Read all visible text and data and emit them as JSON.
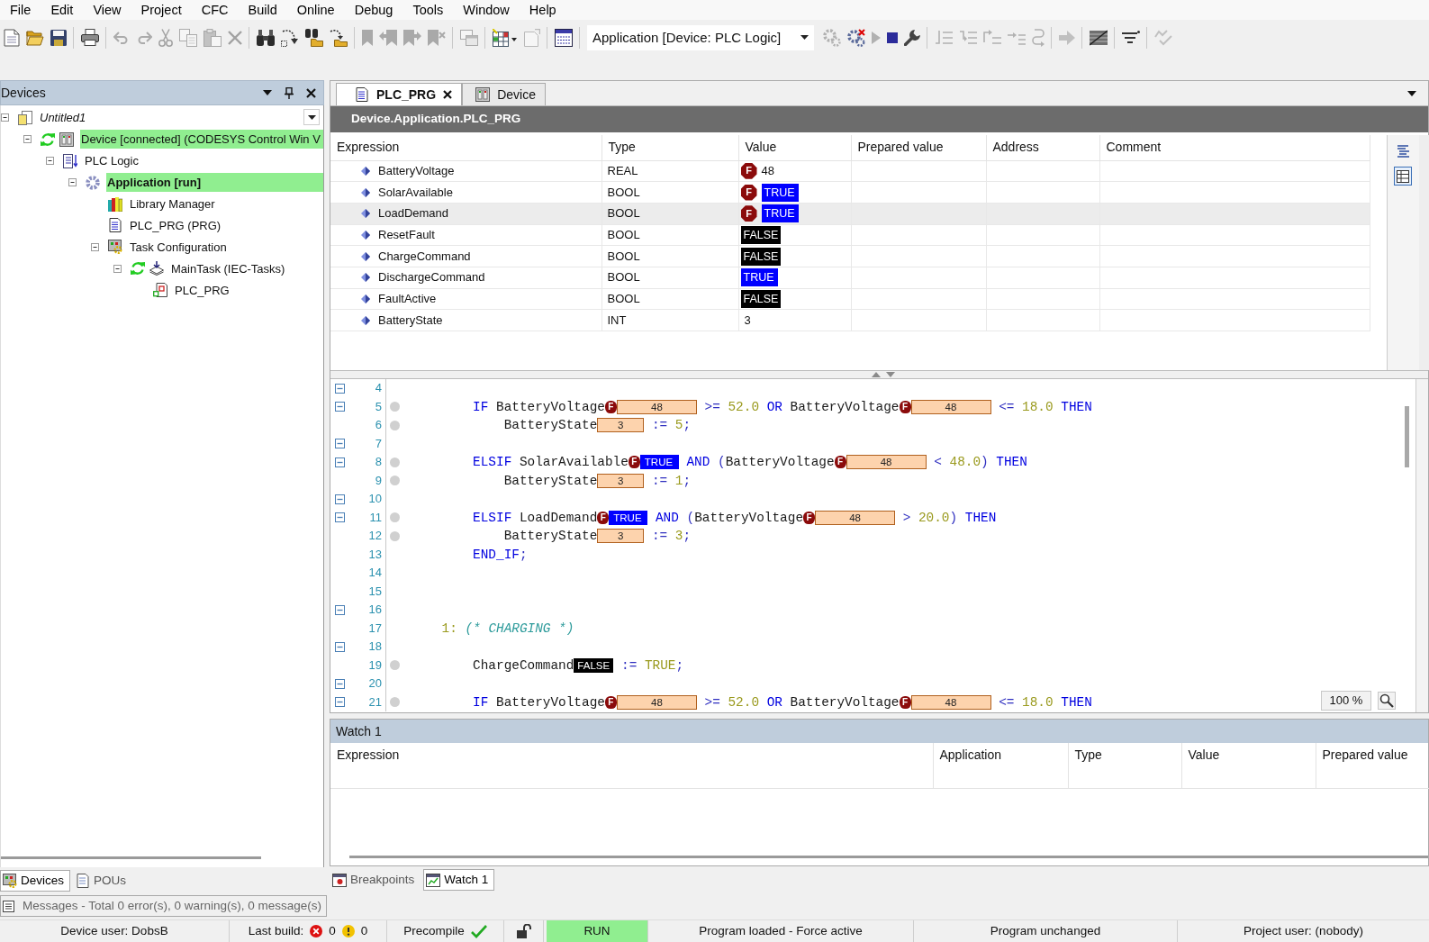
{
  "menu": [
    "File",
    "Edit",
    "View",
    "Project",
    "CFC",
    "Build",
    "Online",
    "Debug",
    "Tools",
    "Window",
    "Help"
  ],
  "toolbar": [
    {
      "kind": "new",
      "disabled": false
    },
    {
      "kind": "open",
      "disabled": false
    },
    {
      "kind": "save",
      "disabled": false
    },
    {
      "kind": "separator"
    },
    {
      "kind": "print",
      "disabled": false
    },
    {
      "kind": "separator"
    },
    {
      "kind": "undo",
      "disabled": true
    },
    {
      "kind": "redo",
      "disabled": true
    },
    {
      "kind": "cut",
      "disabled": true
    },
    {
      "kind": "copy",
      "disabled": true
    },
    {
      "kind": "paste",
      "disabled": true
    },
    {
      "kind": "delete",
      "disabled": true
    },
    {
      "kind": "separator"
    },
    {
      "kind": "find",
      "disabled": false
    },
    {
      "kind": "findnext",
      "disabled": false
    },
    {
      "kind": "findfiles",
      "disabled": false
    },
    {
      "kind": "replacefiles",
      "disabled": false
    },
    {
      "kind": "separator"
    },
    {
      "kind": "bookmark",
      "disabled": true
    },
    {
      "kind": "bmprev",
      "disabled": true
    },
    {
      "kind": "bmnext",
      "disabled": true
    },
    {
      "kind": "bmclear",
      "disabled": true
    },
    {
      "kind": "separator"
    },
    {
      "kind": "windows",
      "disabled": true
    },
    {
      "kind": "separator"
    },
    {
      "kind": "grid",
      "disabled": false
    },
    {
      "kind": "page",
      "disabled": true
    },
    {
      "kind": "separator"
    },
    {
      "kind": "watch",
      "disabled": false
    },
    {
      "kind": "separator"
    },
    {
      "kind": "selector",
      "text": "Application [Device: PLC Logic]"
    },
    {
      "kind": "login",
      "disabled": true
    },
    {
      "kind": "logout",
      "disabled": false
    },
    {
      "kind": "start",
      "disabled": true
    },
    {
      "kind": "stop",
      "disabled": false
    },
    {
      "kind": "reset",
      "disabled": false
    },
    {
      "kind": "separator"
    },
    {
      "kind": "stepover",
      "disabled": true
    },
    {
      "kind": "stepinto",
      "disabled": true
    },
    {
      "kind": "stepout",
      "disabled": true
    },
    {
      "kind": "runtocursor",
      "disabled": true
    },
    {
      "kind": "shownext",
      "disabled": true
    },
    {
      "kind": "separator"
    },
    {
      "kind": "arrow",
      "disabled": true
    },
    {
      "kind": "separator"
    },
    {
      "kind": "flag",
      "disabled": false
    },
    {
      "kind": "separator"
    },
    {
      "kind": "filter",
      "disabled": false
    },
    {
      "kind": "separator"
    },
    {
      "kind": "check",
      "disabled": true
    }
  ],
  "devices_panel": {
    "title": "Devices",
    "tree": [
      {
        "label": "Untitled1",
        "kind": "project",
        "expanded": true,
        "running": false,
        "highlighted": false,
        "active": false,
        "children": [
          {
            "label": "Device [connected] (CODESYS Control Win V",
            "kind": "device",
            "expanded": true,
            "running": true,
            "highlighted": true,
            "active": false,
            "children": [
              {
                "label": "PLC Logic",
                "kind": "plclogic",
                "expanded": true,
                "running": false,
                "highlighted": false,
                "active": false,
                "children": [
                  {
                    "label": "Application [run]",
                    "kind": "application",
                    "expanded": true,
                    "running": false,
                    "highlighted": true,
                    "active": true,
                    "children": [
                      {
                        "label": "Library Manager",
                        "kind": "library",
                        "running": false,
                        "highlighted": false,
                        "active": false
                      },
                      {
                        "label": "PLC_PRG (PRG)",
                        "kind": "pou",
                        "running": false,
                        "highlighted": false,
                        "active": false
                      },
                      {
                        "label": "Task Configuration",
                        "kind": "taskconfig",
                        "expanded": true,
                        "running": false,
                        "highlighted": false,
                        "active": false,
                        "children": [
                          {
                            "label": "MainTask (IEC-Tasks)",
                            "kind": "task",
                            "expanded": true,
                            "running": true,
                            "highlighted": false,
                            "active": false,
                            "children": [
                              {
                                "label": "PLC_PRG",
                                "kind": "taskpou",
                                "running": false,
                                "highlighted": false,
                                "active": false
                              }
                            ]
                          }
                        ]
                      }
                    ]
                  }
                ]
              }
            ]
          }
        ]
      }
    ],
    "tabs": [
      {
        "label": "Devices",
        "kind": "devices",
        "selected": true
      },
      {
        "label": "POUs",
        "kind": "pous",
        "selected": false
      }
    ]
  },
  "editor": {
    "tabs": [
      {
        "label": "PLC_PRG",
        "kind": "pou",
        "selected": true
      },
      {
        "label": "Device",
        "kind": "device",
        "selected": false
      }
    ],
    "path": "Device.Application.PLC_PRG",
    "variables": {
      "columns": [
        "Expression",
        "Type",
        "Value",
        "Prepared value",
        "Address",
        "Comment"
      ],
      "rows": [
        {
          "expression": "BatteryVoltage",
          "type": "REAL",
          "value": "48",
          "kind": "real",
          "force_mark": "F",
          "selected": false
        },
        {
          "expression": "SolarAvailable",
          "type": "BOOL",
          "value": "TRUE",
          "kind": "true",
          "force_mark": "F",
          "selected": false
        },
        {
          "expression": "LoadDemand",
          "type": "BOOL",
          "value": "TRUE",
          "kind": "true",
          "force_mark": "F",
          "selected": true
        },
        {
          "expression": "ResetFault",
          "type": "BOOL",
          "value": "FALSE",
          "kind": "false",
          "selected": false
        },
        {
          "expression": "ChargeCommand",
          "type": "BOOL",
          "value": "FALSE",
          "kind": "false",
          "selected": false
        },
        {
          "expression": "DischargeCommand",
          "type": "BOOL",
          "value": "TRUE",
          "kind": "true",
          "selected": false
        },
        {
          "expression": "FaultActive",
          "type": "BOOL",
          "value": "FALSE",
          "kind": "false",
          "selected": false
        },
        {
          "expression": "BatteryState",
          "type": "INT",
          "value": "3",
          "kind": "int",
          "selected": false
        }
      ],
      "view_modes": [
        {
          "kind": "text",
          "selected": false
        },
        {
          "kind": "table",
          "selected": true
        }
      ]
    },
    "code": [
      {
        "number": "4",
        "fold": true,
        "breakpoint": false
      },
      {
        "number": "5",
        "fold": true,
        "breakpoint": true,
        "tokens": [
          {
            "kind": "keyword",
            "text": "        IF"
          },
          {
            "kind": "name",
            "text": " BatteryVoltage"
          },
          {
            "kind": "real",
            "value": "48",
            "force_mark": "F"
          },
          {
            "kind": "operator",
            "text": " >="
          },
          {
            "kind": "number",
            "text": " 52.0"
          },
          {
            "kind": "keyword",
            "text": " OR"
          },
          {
            "kind": "name",
            "text": " BatteryVoltage"
          },
          {
            "kind": "real",
            "value": "48",
            "force_mark": "F"
          },
          {
            "kind": "operator",
            "text": " <="
          },
          {
            "kind": "number",
            "text": " 18.0"
          },
          {
            "kind": "keyword",
            "text": " THEN"
          }
        ]
      },
      {
        "number": "6",
        "fold": false,
        "breakpoint": true,
        "tokens": [
          {
            "kind": "name",
            "text": "            BatteryState"
          },
          {
            "kind": "int",
            "value": "3"
          },
          {
            "kind": "operator",
            "text": " :="
          },
          {
            "kind": "number",
            "text": " 5"
          },
          {
            "kind": "operator",
            "text": ";"
          }
        ]
      },
      {
        "number": "7",
        "fold": true,
        "breakpoint": false
      },
      {
        "number": "8",
        "fold": true,
        "breakpoint": true,
        "tokens": [
          {
            "kind": "keyword",
            "text": "        ELSIF"
          },
          {
            "kind": "name",
            "text": " SolarAvailable"
          },
          {
            "kind": "true",
            "value": "TRUE",
            "force_mark": "F"
          },
          {
            "kind": "keyword",
            "text": " AND"
          },
          {
            "kind": "operator",
            "text": " ("
          },
          {
            "kind": "name",
            "text": "BatteryVoltage"
          },
          {
            "kind": "real",
            "value": "48",
            "force_mark": "F"
          },
          {
            "kind": "operator",
            "text": " <"
          },
          {
            "kind": "number",
            "text": " 48.0"
          },
          {
            "kind": "operator",
            "text": ")"
          },
          {
            "kind": "keyword",
            "text": " THEN"
          }
        ]
      },
      {
        "number": "9",
        "fold": false,
        "breakpoint": true,
        "tokens": [
          {
            "kind": "name",
            "text": "            BatteryState"
          },
          {
            "kind": "int",
            "value": "3"
          },
          {
            "kind": "operator",
            "text": " :="
          },
          {
            "kind": "number",
            "text": " 1"
          },
          {
            "kind": "operator",
            "text": ";"
          }
        ]
      },
      {
        "number": "10",
        "fold": true,
        "breakpoint": false
      },
      {
        "number": "11",
        "fold": true,
        "breakpoint": true,
        "tokens": [
          {
            "kind": "keyword",
            "text": "        ELSIF"
          },
          {
            "kind": "name",
            "text": " LoadDemand"
          },
          {
            "kind": "true",
            "value": "TRUE",
            "force_mark": "F"
          },
          {
            "kind": "keyword",
            "text": " AND"
          },
          {
            "kind": "operator",
            "text": " ("
          },
          {
            "kind": "name",
            "text": "BatteryVoltage"
          },
          {
            "kind": "real",
            "value": "48",
            "force_mark": "F"
          },
          {
            "kind": "operator",
            "text": " >"
          },
          {
            "kind": "number",
            "text": " 20.0"
          },
          {
            "kind": "operator",
            "text": ")"
          },
          {
            "kind": "keyword",
            "text": " THEN"
          }
        ]
      },
      {
        "number": "12",
        "fold": false,
        "breakpoint": true,
        "tokens": [
          {
            "kind": "name",
            "text": "            BatteryState"
          },
          {
            "kind": "int",
            "value": "3"
          },
          {
            "kind": "operator",
            "text": " :="
          },
          {
            "kind": "number",
            "text": " 3"
          },
          {
            "kind": "operator",
            "text": ";"
          }
        ]
      },
      {
        "number": "13",
        "fold": false,
        "breakpoint": false,
        "tokens": [
          {
            "kind": "keyword",
            "text": "        END_IF"
          },
          {
            "kind": "operator",
            "text": ";"
          }
        ]
      },
      {
        "number": "14",
        "fold": false,
        "breakpoint": false
      },
      {
        "number": "15",
        "fold": false,
        "breakpoint": false
      },
      {
        "number": "16",
        "fold": true,
        "breakpoint": false
      },
      {
        "number": "17",
        "fold": false,
        "breakpoint": false,
        "tokens": [
          {
            "kind": "label",
            "text": "    1:"
          },
          {
            "kind": "comment",
            "text": " (* CHARGING *)"
          }
        ]
      },
      {
        "number": "18",
        "fold": true,
        "breakpoint": false
      },
      {
        "number": "19",
        "fold": false,
        "breakpoint": true,
        "tokens": [
          {
            "kind": "name",
            "text": "        ChargeCommand"
          },
          {
            "kind": "false",
            "value": "FALSE"
          },
          {
            "kind": "operator",
            "text": " :="
          },
          {
            "kind": "number",
            "text": " TRUE"
          },
          {
            "kind": "operator",
            "text": ";"
          }
        ]
      },
      {
        "number": "20",
        "fold": true,
        "breakpoint": false
      },
      {
        "number": "21",
        "fold": true,
        "breakpoint": true,
        "tokens": [
          {
            "kind": "keyword",
            "text": "        IF"
          },
          {
            "kind": "name",
            "text": " BatteryVoltage"
          },
          {
            "kind": "real",
            "value": "48",
            "force_mark": "F"
          },
          {
            "kind": "operator",
            "text": " >="
          },
          {
            "kind": "number",
            "text": " 52.0"
          },
          {
            "kind": "keyword",
            "text": " OR"
          },
          {
            "kind": "name",
            "text": " BatteryVoltage"
          },
          {
            "kind": "real",
            "value": "48",
            "force_mark": "F"
          },
          {
            "kind": "operator",
            "text": " <="
          },
          {
            "kind": "number",
            "text": " 18.0"
          },
          {
            "kind": "keyword",
            "text": " THEN"
          }
        ]
      }
    ],
    "zoom": "100 %"
  },
  "watch_panel": {
    "title": "Watch 1",
    "columns": [
      "Expression",
      "Application",
      "Type",
      "Value",
      "Prepared value"
    ],
    "tabs": [
      {
        "label": "Breakpoints",
        "kind": "breakpoints",
        "selected": false
      },
      {
        "label": "Watch 1",
        "kind": "watch",
        "selected": true
      }
    ]
  },
  "messages": {
    "label": "Messages - Total 0 error(s), 0 warning(s), 0 message(s)"
  },
  "status_bar": {
    "device_user": "Device user: DobsB",
    "last_build": {
      "label": "Last build:",
      "errors": "0",
      "warnings": "0"
    },
    "precompile": {
      "label": "Precompile",
      "ok": true
    },
    "locked": false,
    "run": {
      "label": "RUN",
      "running": true
    },
    "program_state": "Program loaded - Force active",
    "change_state": "Program unchanged",
    "project_user": "Project user: (nobody)"
  }
}
